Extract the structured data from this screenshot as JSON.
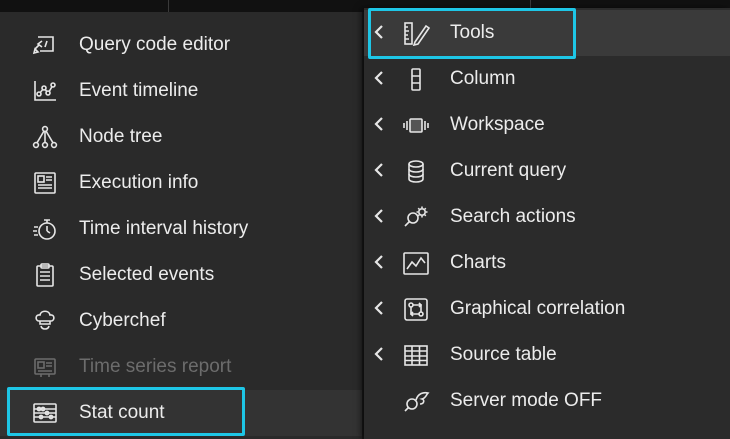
{
  "left_menu": {
    "items": [
      {
        "label": "Query code editor",
        "icon": "code-editor-icon"
      },
      {
        "label": "Event timeline",
        "icon": "timeline-chart-icon"
      },
      {
        "label": "Node tree",
        "icon": "node-tree-icon"
      },
      {
        "label": "Execution info",
        "icon": "execution-info-icon"
      },
      {
        "label": "Time interval history",
        "icon": "stopwatch-history-icon"
      },
      {
        "label": "Selected events",
        "icon": "clipboard-list-icon"
      },
      {
        "label": "Cyberchef",
        "icon": "chef-hat-icon"
      },
      {
        "label": "Time series report",
        "icon": "report-icon",
        "disabled": true
      },
      {
        "label": "Stat count",
        "icon": "abacus-icon",
        "highlighted": true
      }
    ]
  },
  "right_menu": {
    "items": [
      {
        "label": "Tools",
        "icon": "ruler-pencil-icon",
        "submenu": true,
        "highlighted": true
      },
      {
        "label": "Column",
        "icon": "column-icon",
        "submenu": true
      },
      {
        "label": "Workspace",
        "icon": "workspace-icon",
        "submenu": true
      },
      {
        "label": "Current query",
        "icon": "database-icon",
        "submenu": true
      },
      {
        "label": "Search actions",
        "icon": "search-gear-icon",
        "submenu": true
      },
      {
        "label": "Charts",
        "icon": "line-chart-icon",
        "submenu": true
      },
      {
        "label": "Graphical correlation",
        "icon": "correlation-icon",
        "submenu": true
      },
      {
        "label": "Source table",
        "icon": "table-icon",
        "submenu": true
      },
      {
        "label": "Server mode OFF",
        "icon": "server-mode-icon",
        "submenu": false
      }
    ]
  },
  "colors": {
    "focus_outline": "#1ec6e6",
    "menu_bg": "#2a2a2a",
    "text": "#ececec",
    "disabled_text": "#6c6c6c"
  }
}
